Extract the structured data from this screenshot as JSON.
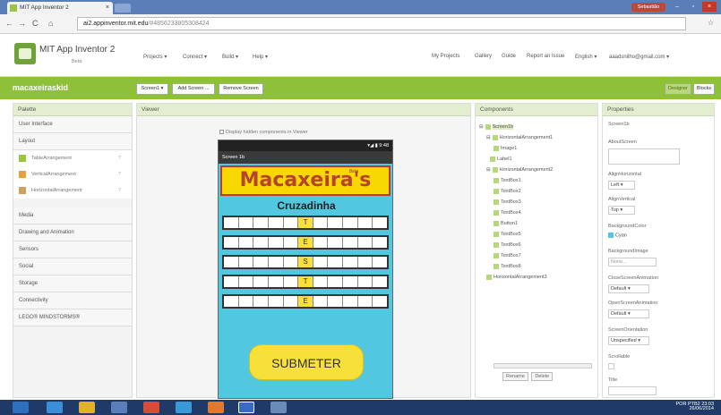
{
  "browser": {
    "tab_title": "MIT App Inventor 2",
    "tab_close": "×",
    "user_badge": "Sebastião",
    "url_main": "ai2.appinventor.mit.edu",
    "url_rest": "/#4856233805308424",
    "win_min": "–",
    "win_max": "▫",
    "win_close": "×"
  },
  "app": {
    "title": "MIT App Inventor 2",
    "beta": "Beta",
    "menu": [
      "Projects ▾",
      "Connect ▾",
      "Build ▾",
      "Help ▾"
    ],
    "right_menu": [
      "My Projects",
      "Gallery",
      "Guide",
      "Report an Issue",
      "English ▾",
      "aaadsnilho@gmail.com ▾"
    ]
  },
  "toolbar": {
    "project_name": "macaxeiraskid",
    "screen_button": "Screen1 ▾",
    "add_screen": "Add Screen ...",
    "remove_screen": "Remove Screen",
    "designer": "Designer",
    "blocks": "Blocks"
  },
  "palette": {
    "header": "Palette",
    "categories_top": [
      "User Interface",
      "Layout"
    ],
    "layout_items": [
      "TableArrangement",
      "VerticalArrangement",
      "HorizontalArrangement"
    ],
    "help_glyph": "?",
    "categories_bottom": [
      "Media",
      "Drawing and Animation",
      "Sensors",
      "Social",
      "Storage",
      "Connectivity",
      "LEGO® MINDSTORMS®"
    ]
  },
  "viewer": {
    "header": "Viewer",
    "hidden_checkbox": "Display hidden components in Viewer",
    "status": "▾◢ ▮ 9:48",
    "screen_title": "Screen 1b",
    "banner": "Macaxeira's",
    "banner_beta": "Beta",
    "subtitle": "Cruzadinha",
    "letters": [
      "T",
      "E",
      "S",
      "T",
      "E"
    ],
    "submit": "SUBMETER"
  },
  "components": {
    "header": "Components",
    "tree": [
      {
        "label": "Screen1b",
        "selected": true,
        "toggle": "⊟"
      },
      {
        "label": "HorizontalArrangement1",
        "toggle": "⊟"
      },
      {
        "label": "Image1"
      },
      {
        "label": "Label1"
      },
      {
        "label": "HorizontalArrangement2",
        "toggle": "⊟"
      },
      {
        "label": "TextBox1"
      },
      {
        "label": "TextBox2"
      },
      {
        "label": "TextBox3"
      },
      {
        "label": "TextBox4"
      },
      {
        "label": "Button1"
      },
      {
        "label": "TextBox5"
      },
      {
        "label": "TextBox6"
      },
      {
        "label": "TextBox7"
      },
      {
        "label": "TextBox8"
      },
      {
        "label": "HorizontalArrangement3"
      }
    ],
    "rename": "Rename",
    "delete": "Delete"
  },
  "properties": {
    "header": "Properties",
    "component": "Screen1b",
    "about_label": "AboutScreen",
    "align_h_label": "AlignHorizontal",
    "align_h_value": "Left ▾",
    "align_v_label": "AlignVertical",
    "align_v_value": "Top ▾",
    "bgcolor_label": "BackgroundColor",
    "bgcolor_value": "Cyan",
    "bgimage_label": "BackgroundImage",
    "bgimage_value": "None...",
    "close_anim_label": "CloseScreenAnimation",
    "close_anim_value": "Default ▾",
    "open_anim_label": "OpenScreenAnimation",
    "open_anim_value": "Default ▾",
    "orientation_label": "ScreenOrientation",
    "orientation_value": "Unspecified ▾",
    "scrollable_label": "Scrollable",
    "title_label": "Title"
  },
  "taskbar": {
    "lang": "POR PTB2",
    "time": "23:03",
    "date": "26/06/2014"
  }
}
